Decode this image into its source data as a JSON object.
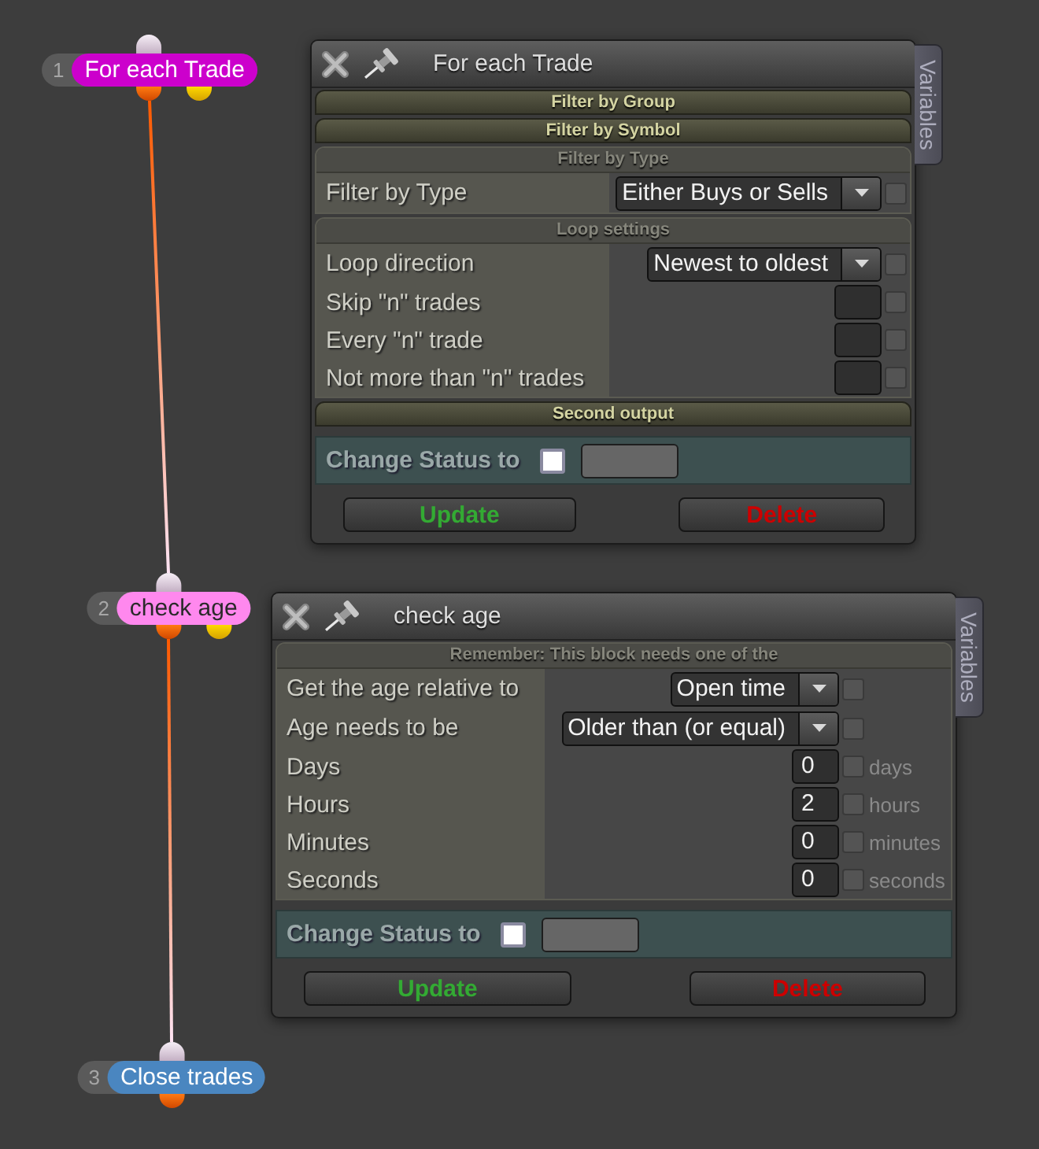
{
  "nodes": [
    {
      "number": "1",
      "label": "For each Trade",
      "color": "#cc00cc",
      "second_output": true
    },
    {
      "number": "2",
      "label": "check age",
      "color": "#ff88ee",
      "second_output": true
    },
    {
      "number": "3",
      "label": "Close trades",
      "color": "#4a86c0",
      "second_output": false
    }
  ],
  "panels": [
    {
      "title": "For each Trade",
      "side_tab": "Variables",
      "sections": [
        {
          "title": "Filter by Group",
          "expanded": false
        },
        {
          "title": "Filter by Symbol",
          "expanded": false
        },
        {
          "title": "Filter by Type",
          "expanded": true,
          "rows": [
            {
              "kind": "dropdown",
              "label": "Filter by Type",
              "value": "Either Buys or Sells",
              "checked": false
            }
          ]
        },
        {
          "title": "Loop settings",
          "expanded": true,
          "rows": [
            {
              "kind": "dropdown",
              "label": "Loop direction",
              "value": "Newest to oldest",
              "checked": false
            },
            {
              "kind": "number",
              "label": "Skip \"n\" trades",
              "checked": false
            },
            {
              "kind": "number",
              "label": "Every \"n\" trade",
              "checked": false
            },
            {
              "kind": "number",
              "label": "Not more than \"n\" trades",
              "checked": false
            }
          ]
        },
        {
          "title": "Second output",
          "expanded": false
        }
      ],
      "status": {
        "label": "Change Status to",
        "checked": false
      },
      "buttons": [
        {
          "kind": "update",
          "label": "Update"
        },
        {
          "kind": "delete",
          "label": "Delete"
        }
      ]
    },
    {
      "title": "check age",
      "side_tab": "Variables",
      "sections": [
        {
          "title": "Remember: This block needs one of the",
          "expanded": true,
          "rows": [
            {
              "kind": "dropdown",
              "label": "Get the age relative to",
              "value": "Open time",
              "checked": false
            },
            {
              "kind": "dropdown",
              "label": "Age needs to be",
              "value": "Older than (or equal)",
              "checked": false
            },
            {
              "kind": "number",
              "label": "Days",
              "value": "0",
              "checked": false,
              "unit": "days"
            },
            {
              "kind": "number",
              "label": "Hours",
              "value": "2",
              "checked": false,
              "unit": "hours"
            },
            {
              "kind": "number",
              "label": "Minutes",
              "value": "0",
              "checked": false,
              "unit": "minutes"
            },
            {
              "kind": "number",
              "label": "Seconds",
              "value": "0",
              "checked": false,
              "unit": "seconds"
            }
          ]
        }
      ],
      "status": {
        "label": "Change Status to",
        "checked": false
      },
      "buttons": [
        {
          "kind": "update",
          "label": "Update"
        },
        {
          "kind": "delete",
          "label": "Delete"
        }
      ]
    }
  ]
}
